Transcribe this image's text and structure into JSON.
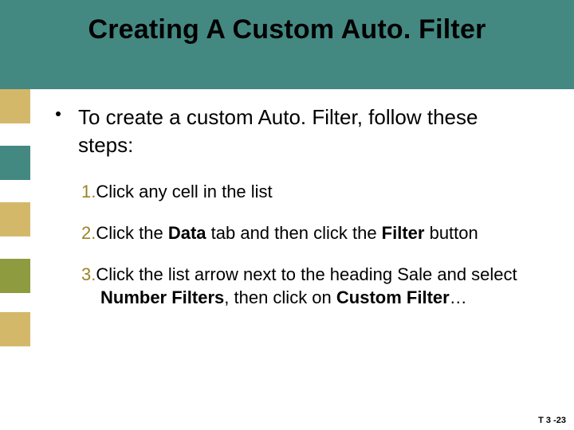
{
  "title": "Creating A Custom Auto. Filter",
  "intro": "To create a custom Auto. Filter, follow these steps:",
  "steps": {
    "s1": {
      "num": "1.",
      "text": "Click any cell in the list"
    },
    "s2": {
      "num": "2.",
      "a": "Click the ",
      "b": "Data",
      "c": " tab and then click the ",
      "d": "Filter",
      "e": " button"
    },
    "s3": {
      "num": "3.",
      "a": "Click the list arrow next to the heading Sale and select ",
      "b": "Number Filters",
      "c": ", then click on ",
      "d": "Custom Filter",
      "e": "…"
    }
  },
  "footer": "T 3 -23"
}
